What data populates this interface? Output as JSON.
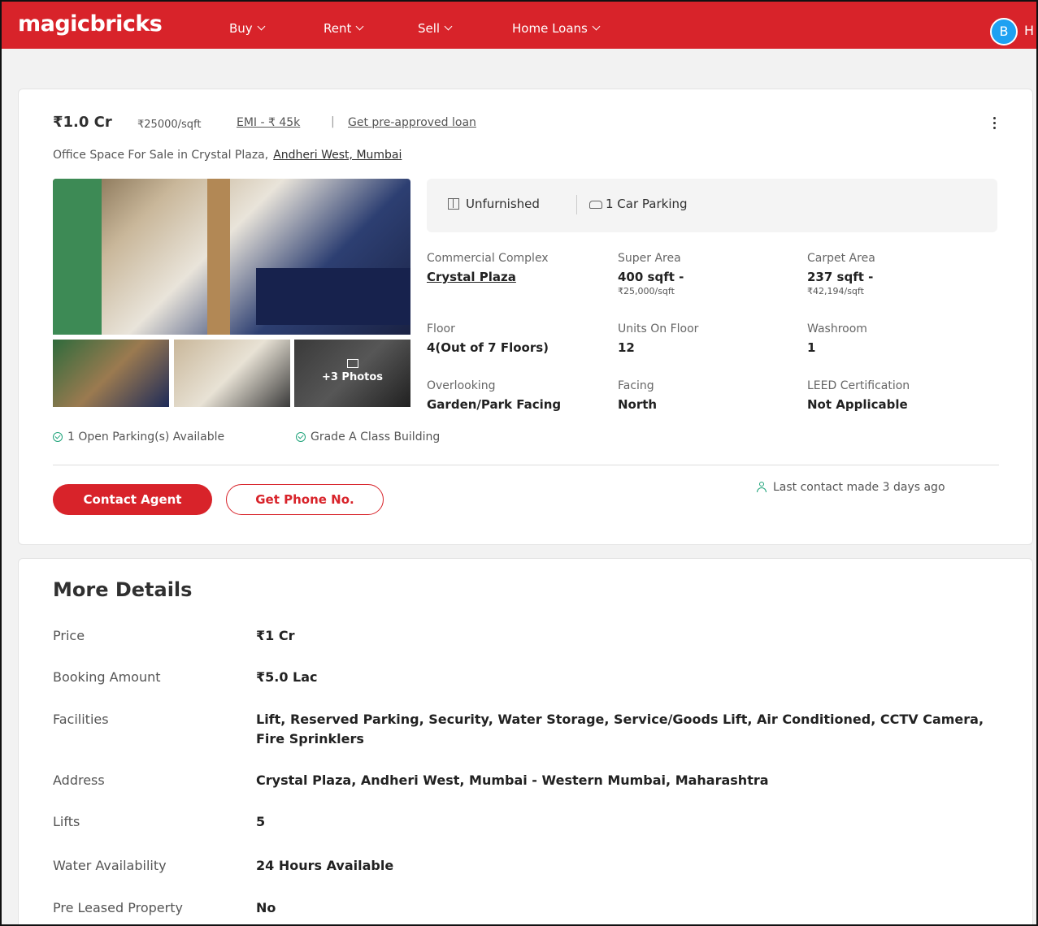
{
  "header": {
    "logo": "magicbricks",
    "nav": [
      {
        "label": "Buy"
      },
      {
        "label": "Rent"
      },
      {
        "label": "Sell"
      },
      {
        "label": "Home Loans"
      }
    ],
    "avatar_initial": "B",
    "avatar_tail": "H",
    "brand_color": "#d8232a"
  },
  "listing": {
    "price": "₹1.0 Cr",
    "price_per_sqft": "₹25000/sqft",
    "emi": "EMI - ₹ 45k",
    "separator": "|",
    "loan_link": "Get pre-approved loan",
    "subtitle": "Office Space For Sale in Crystal Plaza,",
    "location": "Andheri West, Mumbai",
    "gallery": {
      "more_photos": "+3 Photos"
    },
    "summary": {
      "furnishing": "Unfurnished",
      "parking": "1 Car Parking"
    },
    "attributes": [
      {
        "label": "Commercial Complex",
        "value": "Crystal Plaza",
        "sub": ""
      },
      {
        "label": "Super Area",
        "value": "400 sqft -",
        "sub": "₹25,000/sqft"
      },
      {
        "label": "Carpet Area",
        "value": "237 sqft -",
        "sub": "₹42,194/sqft"
      },
      {
        "label": "Floor",
        "value": "4(Out of 7 Floors)",
        "sub": ""
      },
      {
        "label": "Units On Floor",
        "value": "12",
        "sub": ""
      },
      {
        "label": "Washroom",
        "value": "1",
        "sub": ""
      },
      {
        "label": "Overlooking",
        "value": "Garden/Park Facing",
        "sub": ""
      },
      {
        "label": "Facing",
        "value": "North",
        "sub": ""
      },
      {
        "label": "LEED Certification",
        "value": "Not Applicable",
        "sub": ""
      }
    ],
    "features": [
      "1 Open Parking(s) Available",
      "Grade A Class Building"
    ],
    "contact_agent": "Contact Agent",
    "get_phone": "Get Phone No.",
    "last_contact": "Last contact made 3 days ago"
  },
  "more_details": {
    "title": "More Details",
    "rows": [
      {
        "key": "Price",
        "value": "₹1 Cr"
      },
      {
        "key": "Booking Amount",
        "value": "₹5.0 Lac"
      },
      {
        "key": "Facilities",
        "value": "Lift, Reserved Parking, Security, Water Storage, Service/Goods Lift, Air Conditioned, CCTV Camera, Fire Sprinklers"
      },
      {
        "key": "Address",
        "value": "Crystal Plaza, Andheri West, Mumbai - Western Mumbai, Maharashtra"
      },
      {
        "key": "Lifts",
        "value": "5"
      },
      {
        "key": "Water Availability",
        "value": "24 Hours Available"
      },
      {
        "key": "Pre Leased Property",
        "value": "No"
      }
    ]
  }
}
